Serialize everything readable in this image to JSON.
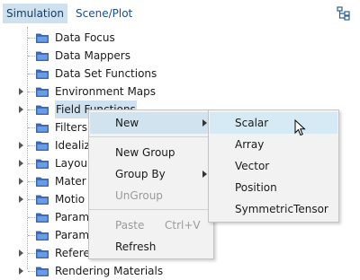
{
  "tabs": [
    {
      "label": "Simulation",
      "active": true
    },
    {
      "label": "Scene/Plot",
      "active": false
    }
  ],
  "toolbar": {
    "tree_toggle_icon": "tree-hierarchy-icon"
  },
  "tree": {
    "items": [
      {
        "label": "Data Focus",
        "expandable": false
      },
      {
        "label": "Data Mappers",
        "expandable": false
      },
      {
        "label": "Data Set Functions",
        "expandable": false
      },
      {
        "label": "Environment Maps",
        "expandable": true
      },
      {
        "label": "Field Functions",
        "expandable": true,
        "selected": true
      },
      {
        "label": "Filters",
        "expandable": false
      },
      {
        "label": "Idealiz",
        "expandable": true
      },
      {
        "label": "Layou",
        "expandable": true
      },
      {
        "label": "Mater",
        "expandable": true
      },
      {
        "label": "Motio",
        "expandable": true
      },
      {
        "label": "Param",
        "expandable": false
      },
      {
        "label": "Param",
        "expandable": false
      },
      {
        "label": "Refere",
        "expandable": true
      },
      {
        "label": "Rendering Materials",
        "expandable": true
      }
    ],
    "folder_icon": "folder-icon",
    "folder_color": "#3a6fc4"
  },
  "context_menu": {
    "items": [
      {
        "label": "New",
        "submenu": true,
        "hover": true
      },
      {
        "label": "New Group"
      },
      {
        "label": "Group By",
        "submenu": true
      },
      {
        "label": "UnGroup",
        "disabled": true
      },
      {
        "label": "Paste",
        "shortcut": "Ctrl+V",
        "disabled": true
      },
      {
        "label": "Refresh"
      }
    ]
  },
  "submenu": {
    "items": [
      {
        "label": "Scalar",
        "hover": true
      },
      {
        "label": "Array"
      },
      {
        "label": "Vector"
      },
      {
        "label": "Position"
      },
      {
        "label": "SymmetricTensor"
      }
    ]
  },
  "colors": {
    "selection": "#cfe1ef",
    "menu_bg": "#f2f2f2",
    "tab_text": "#1c4f8a"
  }
}
